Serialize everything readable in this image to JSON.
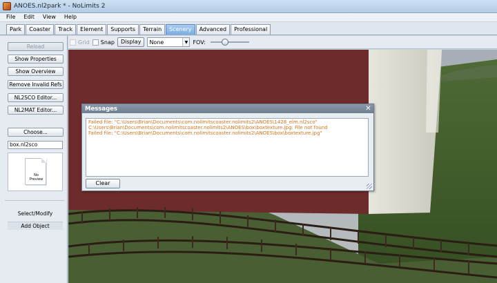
{
  "window": {
    "title": "ANOES.nl2park * - NoLimits 2"
  },
  "menu": [
    "File",
    "Edit",
    "View",
    "Help"
  ],
  "tabs": [
    {
      "label": "Park",
      "active": false
    },
    {
      "label": "Coaster",
      "active": false
    },
    {
      "label": "Track",
      "active": false
    },
    {
      "label": "Element",
      "active": false
    },
    {
      "label": "Supports",
      "active": false
    },
    {
      "label": "Terrain",
      "active": false
    },
    {
      "label": "Scenery",
      "active": true
    },
    {
      "label": "Advanced",
      "active": false
    },
    {
      "label": "Professional",
      "active": false
    }
  ],
  "left_panel": {
    "reload_label": "Reload",
    "show_properties_label": "Show Properties",
    "show_overview_label": "Show Overview",
    "remove_invalid_refs_label": "Remove Invalid Refs",
    "nl2sco_editor_label": "NL2SCO Editor...",
    "nl2mat_editor_label": "NL2MAT Editor...",
    "choose_label": "Choose...",
    "file_name": "box.nl2sco",
    "preview_text": "No Preview",
    "select_modify_label": "Select/Modify",
    "add_object_label": "Add Object"
  },
  "toolbar": {
    "grid_label": "Grid",
    "grid_checked": false,
    "snap_label": "Snap",
    "snap_checked": false,
    "display_label": "Display",
    "display_select_value": "None",
    "fov_label": "FOV:",
    "fov_level": 0.35
  },
  "messages_dialog": {
    "title": "Messages",
    "lines": [
      "Failed file: \"C:\\Users\\Brian\\Documents\\com.nolimitscoaster.nolimits2\\ANOES\\1428_elm.nl2sco\"",
      "C:\\Users\\Brian\\Documents\\com.nolimitscoaster.nolimits2\\ANOES\\box\\boxtexture.jpg: File not found",
      "Failed file: \"C:\\Users\\Brian\\Documents\\com.nolimitscoaster.nolimits2\\ANOES\\box\\boxtexture.jpg\""
    ],
    "clear_label": "Clear"
  },
  "colors": {
    "message_text": "#d2751c",
    "active_tab": "#7aaee4",
    "wall": "#6e2b2b",
    "grass": "#3f5a2a"
  }
}
